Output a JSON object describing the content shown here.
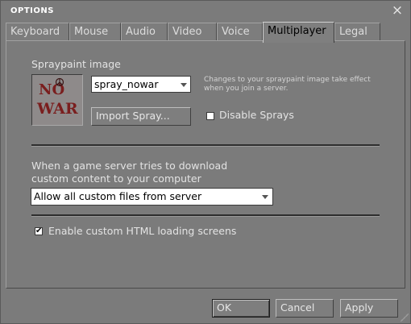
{
  "window": {
    "title": "OPTIONS",
    "close_icon": "×"
  },
  "tabs": [
    {
      "label": "Keyboard",
      "active": false
    },
    {
      "label": "Mouse",
      "active": false
    },
    {
      "label": "Audio",
      "active": false
    },
    {
      "label": "Video",
      "active": false
    },
    {
      "label": "Voice",
      "active": false
    },
    {
      "label": "Multiplayer",
      "active": true
    },
    {
      "label": "Legal",
      "active": false
    }
  ],
  "multiplayer": {
    "spray": {
      "section_label": "Spraypaint image",
      "preview_text_top": "NO",
      "preview_text_bottom": "WAR",
      "selected": "spray_nowar",
      "hint": "Changes to your spraypaint image take effect when you join a server.",
      "import_label": "Import Spray...",
      "disable_sprays_label": "Disable Sprays",
      "disable_sprays_checked": false
    },
    "download": {
      "line1": "When a game server tries to download",
      "line2": "custom content to your computer",
      "selected": "Allow all custom files from server"
    },
    "html_loading": {
      "label": "Enable custom HTML loading screens",
      "checked": true,
      "check_mark": "✔"
    }
  },
  "buttons": {
    "ok": "OK",
    "cancel": "Cancel",
    "apply": "Apply"
  },
  "colors": {
    "window_bg": "#7b7b7b",
    "spray_red": "#7a1e1e"
  }
}
